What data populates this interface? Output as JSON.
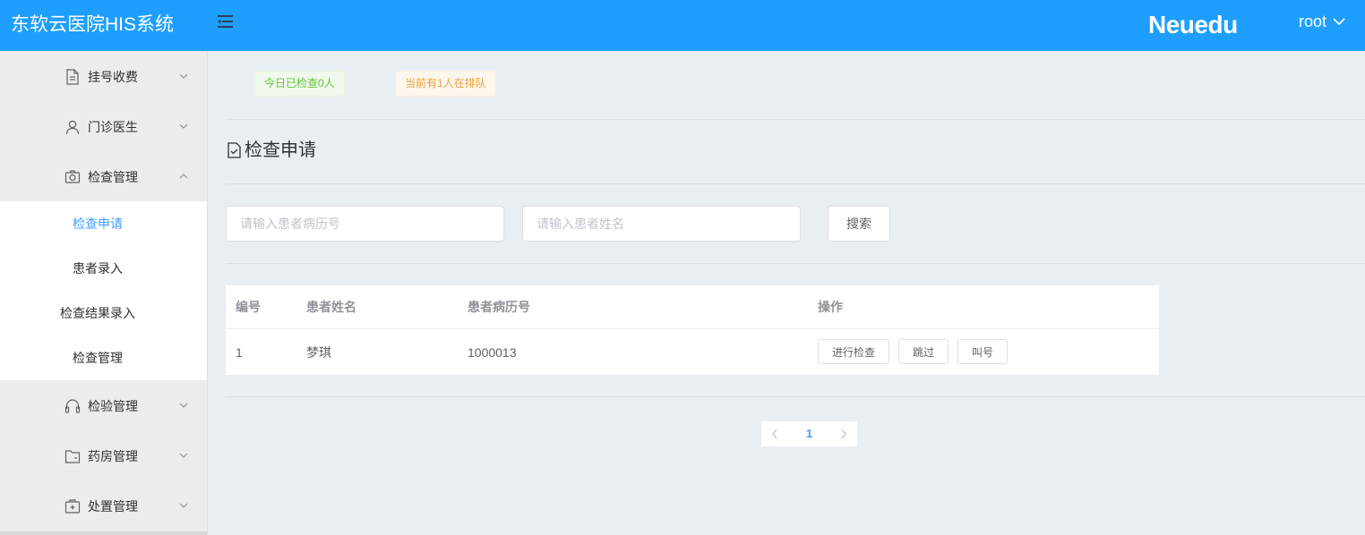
{
  "header": {
    "app_title": "东软云医院HIS系统",
    "brand": "Neuedu",
    "user": "root"
  },
  "colors": {
    "header_bg": "#1e9fff",
    "active_menu": "#409eff",
    "success_badge": "#67c23a",
    "warning_badge": "#e6a23c"
  },
  "sidebar": {
    "items": [
      {
        "label": "挂号收费",
        "icon": "document-icon",
        "expanded": false
      },
      {
        "label": "门诊医生",
        "icon": "user-icon",
        "expanded": false
      },
      {
        "label": "检查管理",
        "icon": "camera-icon",
        "expanded": true,
        "children": [
          {
            "label": "检查申请",
            "active": true
          },
          {
            "label": "患者录入",
            "active": false
          },
          {
            "label": "检查结果录入",
            "active": false
          },
          {
            "label": "检查管理",
            "active": false
          }
        ]
      },
      {
        "label": "检验管理",
        "icon": "headset-icon",
        "expanded": false
      },
      {
        "label": "药房管理",
        "icon": "folder-icon",
        "expanded": false
      },
      {
        "label": "处置管理",
        "icon": "medical-box-icon",
        "expanded": false
      }
    ]
  },
  "status": {
    "checked_today": "今日已检查0人",
    "queue": "当前有1人在排队"
  },
  "page": {
    "title": "检查申请"
  },
  "search": {
    "mrn_placeholder": "请输入患者病历号",
    "name_placeholder": "请输入患者姓名",
    "button": "搜索"
  },
  "table": {
    "headers": [
      "编号",
      "患者姓名",
      "患者病历号",
      "操作"
    ],
    "rows": [
      {
        "id": "1",
        "name": "梦琪",
        "mrn": "1000013"
      }
    ],
    "actions": {
      "exam": "进行检查",
      "skip": "跳过",
      "call": "叫号"
    }
  },
  "pagination": {
    "current": "1"
  }
}
